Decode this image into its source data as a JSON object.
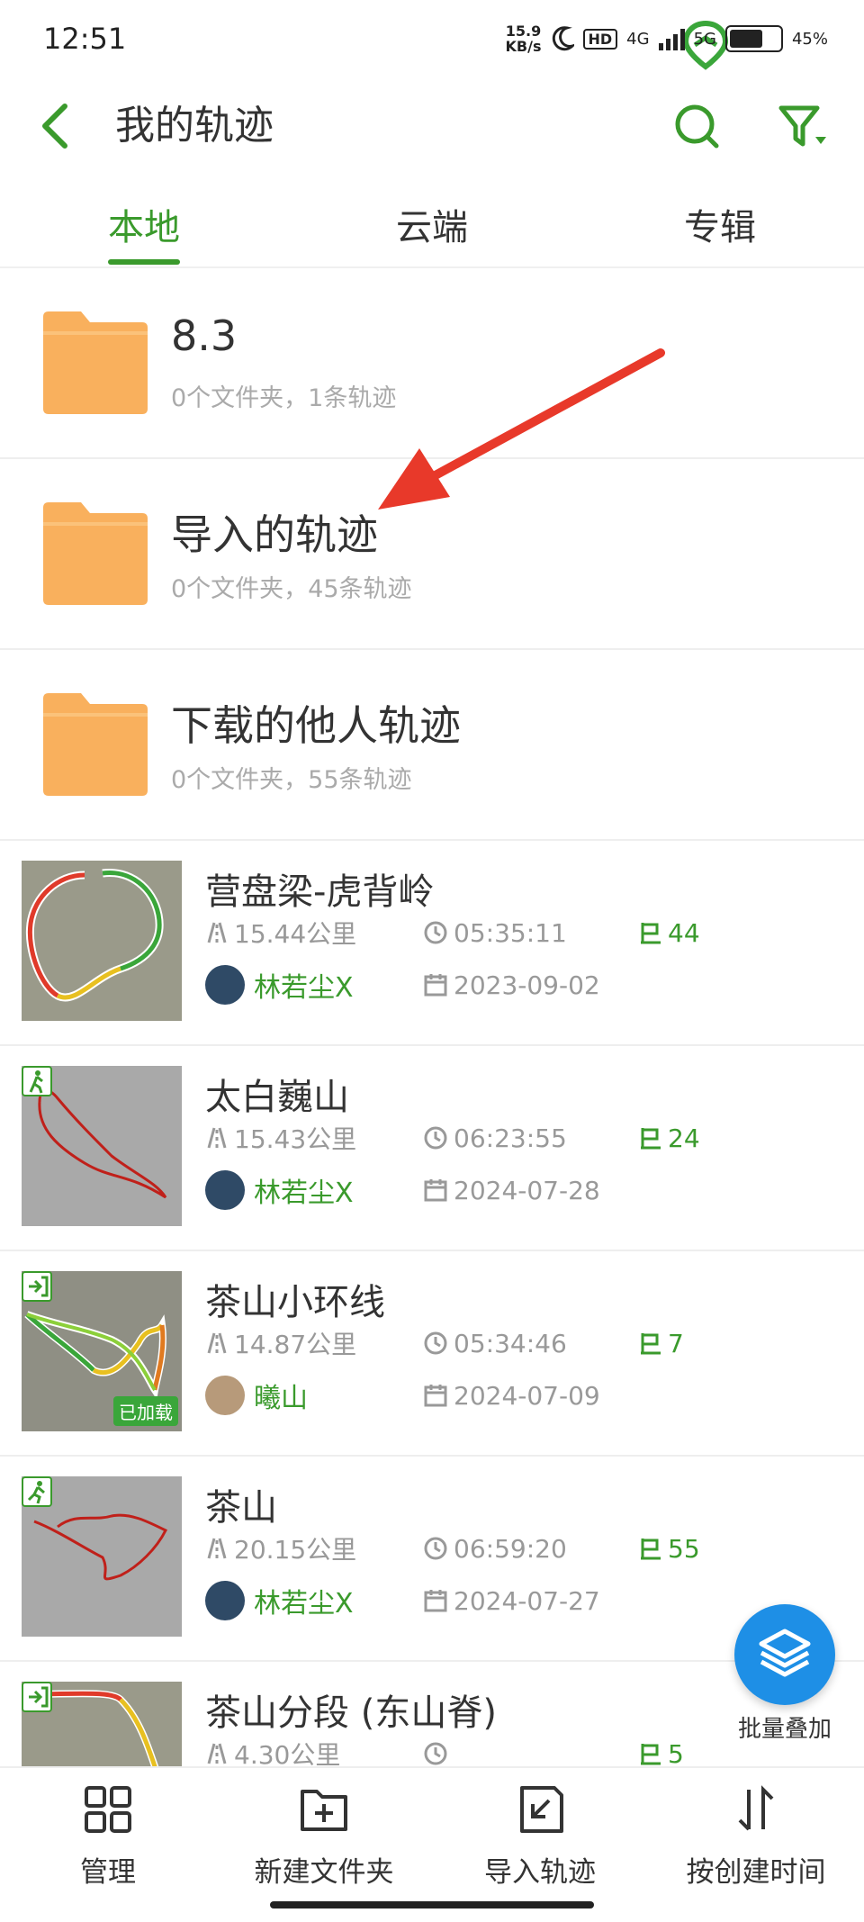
{
  "status_bar": {
    "time": "12:51",
    "speed_value": "15.9",
    "speed_unit": "KB/s",
    "net1": "HD",
    "net2": "4G",
    "net3": "5G",
    "battery": "45%"
  },
  "header": {
    "title": "我的轨迹"
  },
  "tabs": [
    {
      "label": "本地",
      "active": true
    },
    {
      "label": "云端"
    },
    {
      "label": "专辑"
    }
  ],
  "folders": [
    {
      "name": "8.3",
      "meta": "0个文件夹，1条轨迹"
    },
    {
      "name": "导入的轨迹",
      "meta": "0个文件夹，45条轨迹"
    },
    {
      "name": "下载的他人轨迹",
      "meta": "0个文件夹，55条轨迹"
    }
  ],
  "tracks": [
    {
      "name": "营盘梁-虎背岭",
      "distance": "15.44公里",
      "duration": "05:35:11",
      "waypoints": "44",
      "user": "林若尘X",
      "date": "2023-09-02",
      "loaded": false
    },
    {
      "name": "太白巍山",
      "distance": "15.43公里",
      "duration": "06:23:55",
      "waypoints": "24",
      "user": "林若尘X",
      "date": "2024-07-28",
      "loaded": false
    },
    {
      "name": "茶山小环线",
      "distance": "14.87公里",
      "duration": "05:34:46",
      "waypoints": "7",
      "user": "曦山",
      "date": "2024-07-09",
      "loaded": true,
      "loaded_label": "已加载"
    },
    {
      "name": "茶山",
      "distance": "20.15公里",
      "duration": "06:59:20",
      "waypoints": "55",
      "user": "林若尘X",
      "date": "2024-07-27",
      "loaded": false
    },
    {
      "name": "茶山分段 (东山脊)",
      "distance": "4.30公里",
      "duration": "",
      "waypoints": "5",
      "user": "",
      "date": "",
      "loaded": false
    }
  ],
  "fab": {
    "label": "批量叠加"
  },
  "bottom_bar": [
    {
      "label": "管理"
    },
    {
      "label": "新建文件夹"
    },
    {
      "label": "导入轨迹"
    },
    {
      "label": "按创建时间"
    }
  ],
  "colors": {
    "accent": "#3a9a2c",
    "folder": "#f9b05d",
    "fab": "#1e8fe6",
    "arrow": "#e8392a"
  }
}
